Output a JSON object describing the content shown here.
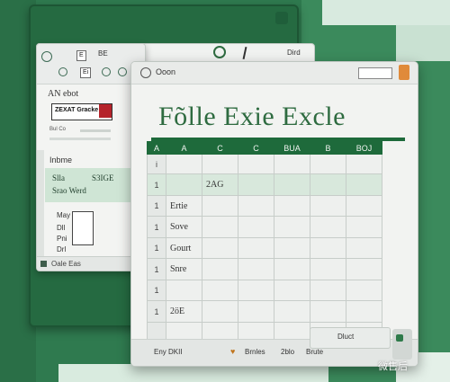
{
  "left_window": {
    "toolbar_box_1": "E",
    "toolbar_text_1": "BE",
    "toolbar_box_2": "Ei",
    "title": "AN ebot",
    "badge_text": "ZEXAT Gracke",
    "caption": "Bul Co",
    "intro": "Inbme",
    "green_line_1": "Slla",
    "green_line_2": "S3IGE",
    "green_line_3": "Srao Werd",
    "rows": [
      "May",
      "Dll",
      "Pni",
      "Drl"
    ],
    "bottom_text": "Oale Eas"
  },
  "middle_window": {
    "toolbar_label": "Dird"
  },
  "main_window": {
    "title": "Ooon",
    "heading": "Fõlle  Exie  Excle",
    "columns": [
      "A",
      "A",
      "C",
      "C",
      "BUA",
      "B",
      "BOJ"
    ],
    "rows": [
      {
        "num": "i",
        "cells": [
          "",
          "",
          "",
          "",
          "",
          ""
        ]
      },
      {
        "num": "1",
        "cells": [
          "",
          "2AG",
          "",
          "",
          "",
          ""
        ]
      },
      {
        "num": "1",
        "cells": [
          "Ertie",
          "",
          "",
          "",
          "",
          ""
        ]
      },
      {
        "num": "1",
        "cells": [
          "Sove",
          "",
          "",
          "",
          "",
          ""
        ]
      },
      {
        "num": "1",
        "cells": [
          "Gourt",
          "",
          "",
          "",
          "",
          ""
        ]
      },
      {
        "num": "1",
        "cells": [
          "Snre",
          "",
          "",
          "",
          "",
          ""
        ]
      },
      {
        "num": "1",
        "cells": [
          "",
          "",
          "",
          "",
          "",
          ""
        ]
      },
      {
        "num": "1",
        "cells": [
          "2ӧE",
          "",
          "",
          "",
          "",
          ""
        ]
      },
      {
        "num": "",
        "cells": [
          "",
          "",
          "",
          "",
          "",
          ""
        ]
      }
    ],
    "status": {
      "left": "Eny DKII",
      "heart": "♥",
      "mid_1": "Brnles",
      "mid_2": "2blo",
      "mid_3": "Brute",
      "panel": "Dluct"
    }
  },
  "watermark": "微售后"
}
